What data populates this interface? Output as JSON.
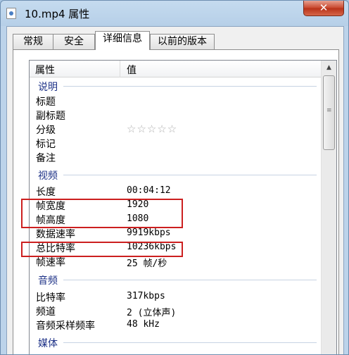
{
  "window": {
    "title": "10.mp4 属性",
    "close_glyph": "✕"
  },
  "tabs": [
    {
      "label": "常规"
    },
    {
      "label": "安全"
    },
    {
      "label": "详细信息"
    },
    {
      "label": "以前的版本"
    }
  ],
  "active_tab": "详细信息",
  "columns": {
    "name": "属性",
    "value": "值"
  },
  "sections": {
    "description": {
      "title": "说明",
      "rows": [
        {
          "label": "标题",
          "value": ""
        },
        {
          "label": "副标题",
          "value": ""
        },
        {
          "label": "分级",
          "value": ""
        },
        {
          "label": "标记",
          "value": ""
        },
        {
          "label": "备注",
          "value": ""
        }
      ],
      "rating_stars": "☆☆☆☆☆",
      "rating_value": 0
    },
    "video": {
      "title": "视频",
      "rows": [
        {
          "label": "长度",
          "value": "00:04:12"
        },
        {
          "label": "帧宽度",
          "value": "1920"
        },
        {
          "label": "帧高度",
          "value": "1080"
        },
        {
          "label": "数据速率",
          "value": "9919kbps"
        },
        {
          "label": "总比特率",
          "value": "10236kbps"
        },
        {
          "label": "帧速率",
          "value": "25 帧/秒"
        }
      ]
    },
    "audio": {
      "title": "音频",
      "rows": [
        {
          "label": "比特率",
          "value": "317kbps"
        },
        {
          "label": "频道",
          "value": "2 (立体声)"
        },
        {
          "label": "音频采样频率",
          "value": "48 kHz"
        }
      ]
    },
    "media": {
      "title": "媒体"
    }
  },
  "colors": {
    "section_title": "#1e3287",
    "highlight_box": "#cc1f1f"
  }
}
